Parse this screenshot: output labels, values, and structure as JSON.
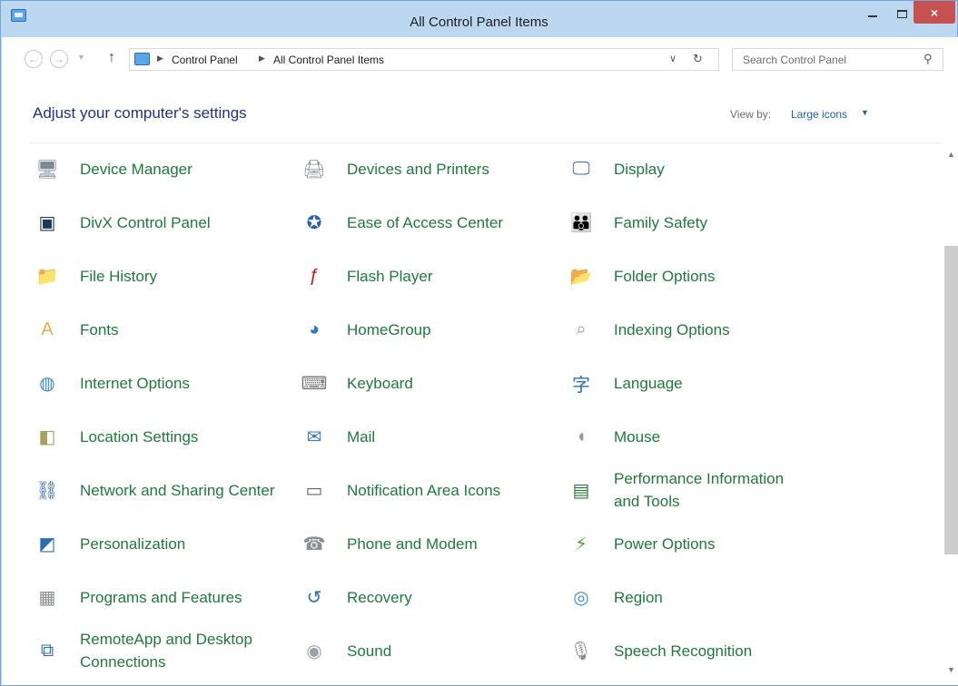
{
  "window": {
    "title": "All Control Panel Items",
    "close_glyph": "×"
  },
  "toolbar": {
    "back_glyph": "←",
    "forward_glyph": "→",
    "up_glyph": "↑",
    "breadcrumbs": [
      "Control Panel",
      "All Control Panel Items"
    ],
    "search_placeholder": "Search Control Panel"
  },
  "content": {
    "heading": "Adjust your computer's settings",
    "view_by_label": "View by:",
    "view_by_value": "Large icons"
  },
  "items": [
    {
      "label": "Device Manager",
      "icon": "device-manager-icon",
      "color": "#7a8a99"
    },
    {
      "label": "Devices and Printers",
      "icon": "devices-printers-icon",
      "color": "#8a8f94"
    },
    {
      "label": "Display",
      "icon": "display-icon",
      "color": "#2a6fb5"
    },
    {
      "label": "DivX Control Panel",
      "icon": "divx-icon",
      "color": "#1a3a5c"
    },
    {
      "label": "Ease of Access Center",
      "icon": "ease-of-access-icon",
      "color": "#2a5fb0"
    },
    {
      "label": "Family Safety",
      "icon": "family-safety-icon",
      "color": "#4a8ad0"
    },
    {
      "label": "File History",
      "icon": "file-history-icon",
      "color": "#d9b24a"
    },
    {
      "label": "Flash Player",
      "icon": "flash-player-icon",
      "color": "#c21a1a"
    },
    {
      "label": "Folder Options",
      "icon": "folder-options-icon",
      "color": "#e2c46a"
    },
    {
      "label": "Fonts",
      "icon": "fonts-icon",
      "color": "#d9b24a"
    },
    {
      "label": "HomeGroup",
      "icon": "homegroup-icon",
      "color": "#2a7ad0"
    },
    {
      "label": "Indexing Options",
      "icon": "indexing-options-icon",
      "color": "#9aa3ab"
    },
    {
      "label": "Internet Options",
      "icon": "internet-options-icon",
      "color": "#3a8ad8"
    },
    {
      "label": "Keyboard",
      "icon": "keyboard-icon",
      "color": "#777777"
    },
    {
      "label": "Language",
      "icon": "language-icon",
      "color": "#2a6fb5"
    },
    {
      "label": "Location Settings",
      "icon": "location-settings-icon",
      "color": "#a9a060"
    },
    {
      "label": "Mail",
      "icon": "mail-icon",
      "color": "#3a7ac8"
    },
    {
      "label": "Mouse",
      "icon": "mouse-icon",
      "color": "#9a9a9a"
    },
    {
      "label": "Network and Sharing Center",
      "icon": "network-sharing-icon",
      "color": "#2a5fb0"
    },
    {
      "label": "Notification Area Icons",
      "icon": "notification-area-icon",
      "color": "#666666"
    },
    {
      "label": "Performance Information and Tools",
      "icon": "performance-icon",
      "color": "#2a7a3a"
    },
    {
      "label": "Personalization",
      "icon": "personalization-icon",
      "color": "#2a6fb5"
    },
    {
      "label": "Phone and Modem",
      "icon": "phone-modem-icon",
      "color": "#8a8f94"
    },
    {
      "label": "Power Options",
      "icon": "power-options-icon",
      "color": "#4aa83a"
    },
    {
      "label": "Programs and Features",
      "icon": "programs-features-icon",
      "color": "#8a8f94"
    },
    {
      "label": "Recovery",
      "icon": "recovery-icon",
      "color": "#2a6fb5"
    },
    {
      "label": "Region",
      "icon": "region-icon",
      "color": "#3a8ad8"
    },
    {
      "label": "RemoteApp and Desktop Connections",
      "icon": "remoteapp-icon",
      "color": "#2a6fb5"
    },
    {
      "label": "Sound",
      "icon": "sound-icon",
      "color": "#9aa3ab"
    },
    {
      "label": "Speech Recognition",
      "icon": "speech-recognition-icon",
      "color": "#8a8f94"
    }
  ]
}
